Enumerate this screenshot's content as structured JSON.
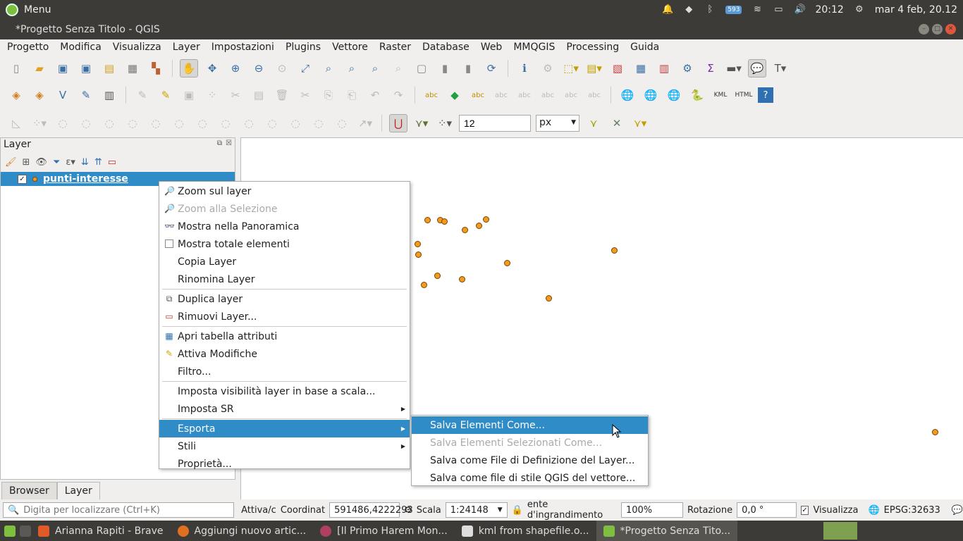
{
  "system": {
    "menu_label": "Menu",
    "badge": "593",
    "time": "20:12",
    "date": "mar 4 feb, 20.12"
  },
  "window": {
    "title": "*Progetto Senza Titolo - QGIS"
  },
  "menubar": [
    "Progetto",
    "Modifica",
    "Visualizza",
    "Layer",
    "Impostazioni",
    "Plugins",
    "Vettore",
    "Raster",
    "Database",
    "Web",
    "MMQGIS",
    "Processing",
    "Guida"
  ],
  "toolbar3": {
    "snap_tolerance": "12",
    "snap_unit": "px"
  },
  "layer_panel": {
    "title": "Layer",
    "layer_name": "punti-interesse",
    "checked": "✓",
    "tabs": [
      "Browser",
      "Layer"
    ]
  },
  "context_menu": {
    "items": [
      "Zoom sul layer",
      "Zoom alla Selezione",
      "Mostra nella Panoramica",
      "Mostra totale elementi",
      "Copia Layer",
      "Rinomina Layer",
      "Duplica layer",
      "Rimuovi Layer...",
      "Apri tabella attributi",
      "Attiva Modifiche",
      "Filtro...",
      "Imposta visibilità layer in base a scala...",
      "Imposta SR",
      "Esporta",
      "Stili",
      "Proprietà..."
    ]
  },
  "export_submenu": {
    "items": [
      "Salva Elementi Come...",
      "Salva Elementi Selezionati Come...",
      "Salva come File di Definizione del Layer...",
      "Salva come file di stile QGIS del vettore..."
    ]
  },
  "statusbar": {
    "search_placeholder": "Digita per localizzare (Ctrl+K)",
    "attiva": "Attiva/c",
    "coord_label": "Coordinat",
    "coord_value": "591486,4222293",
    "scale_label": "Scala",
    "scale_value": "1:24148",
    "magnifier_label": "ente d'ingrandimento",
    "magnifier_value": "100%",
    "rotation_label": "Rotazione",
    "rotation_value": "0,0 °",
    "render_label": "Visualizza",
    "crs": "EPSG:32633"
  },
  "taskbar": [
    "Arianna Rapiti - Brave",
    "Aggiungi nuovo artic...",
    "[Il Primo Harem Mon...",
    "kml from shapefile.o...",
    "*Progetto Senza Tito..."
  ],
  "colors": {
    "highlight": "#308cc6",
    "point_fill": "#f29b1f"
  }
}
